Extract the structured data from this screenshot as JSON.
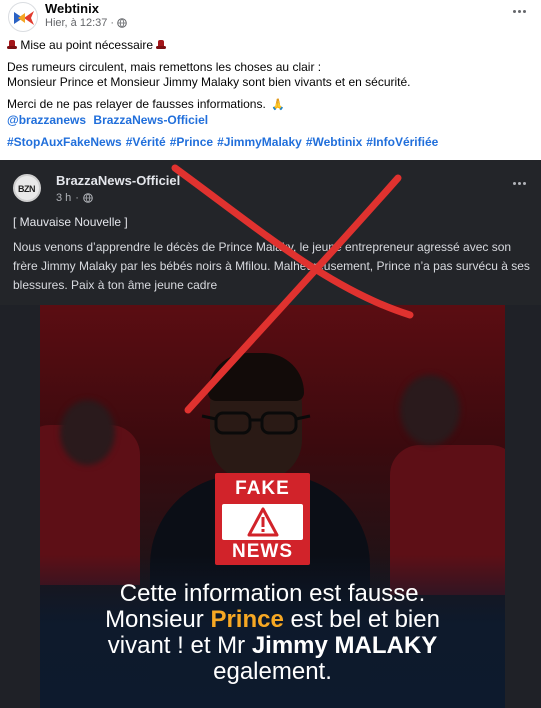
{
  "post": {
    "author": "Webtinix",
    "timestamp": "Hier, à 12:37",
    "separator": "·",
    "visibility_icon": "globe-icon",
    "more_icon": "more-icon"
  },
  "caption": {
    "heading": "Mise au point nécessaire",
    "line1": "Des rumeurs circulent, mais remettons les choses au clair :",
    "line2": "Monsieur Prince et Monsieur Jimmy Malaky sont bien vivants et en sécurité.",
    "line3": "Merci de ne pas relayer de fausses informations.",
    "mention1": "@brazzanews",
    "mention2": "BrazzaNews-Officiel",
    "hashtags": [
      "#StopAuxFakeNews",
      "#Vérité",
      "#Prince",
      "#JimmyMalaky",
      "#Webtinix",
      "#InfoVérifiée"
    ]
  },
  "shared": {
    "author": "BrazzaNews-Officiel",
    "time": "3 h",
    "separator": "·",
    "avatar_text": "BZN",
    "title": "[ Mauvaise Nouvelle  ]",
    "body": "Nous venons d’apprendre le décès de Prince Malaky, le jeune entrepreneur agressé avec son frère Jimmy Malaky par les bébés noirs à Mfilou. Malheureusement, Prince n’a pas survécu à ses blessures. Paix à ton âme jeune cadre",
    "badge_top": "FAKE",
    "badge_bottom": "NEWS",
    "overlay_line1": "Cette information est fausse.",
    "overlay_line2_a": "Monsieur",
    "overlay_line2_b": "Prince",
    "overlay_line2_c": "est bel et bien",
    "overlay_line3_a": "vivant ! et Mr",
    "overlay_line3_b": "Jimmy MALAKY",
    "overlay_line4": "egalement."
  },
  "colors": {
    "link": "#216fdb",
    "badge": "#d1232a",
    "highlight": "#f7a823",
    "cross": "#e0322f"
  }
}
